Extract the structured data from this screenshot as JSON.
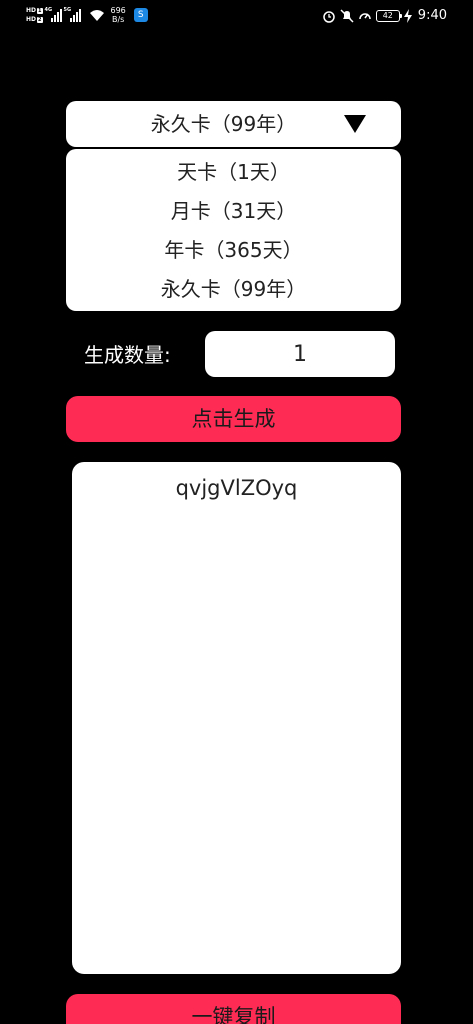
{
  "status_bar": {
    "hd1": "HD",
    "hd1_sim": "1",
    "hd2": "HD",
    "hd2_sim": "2",
    "sig1_type": "4G",
    "sig2_type": "5G",
    "net_speed_value": "696",
    "net_speed_unit": "B/s",
    "app_badge": "S",
    "battery_level": "42",
    "time": "9:40"
  },
  "card_type": {
    "selected": "永久卡（99年）",
    "options": [
      "天卡（1天）",
      "月卡（31天）",
      "年卡（365天）",
      "永久卡（99年）"
    ]
  },
  "quantity": {
    "label": "生成数量:",
    "value": "1"
  },
  "generate_button": "点击生成",
  "output_text": "qvjgVlZOyq",
  "copy_button": "一键复制",
  "colors": {
    "background": "#000000",
    "accent": "#fe2c55",
    "panel": "#ffffff"
  }
}
